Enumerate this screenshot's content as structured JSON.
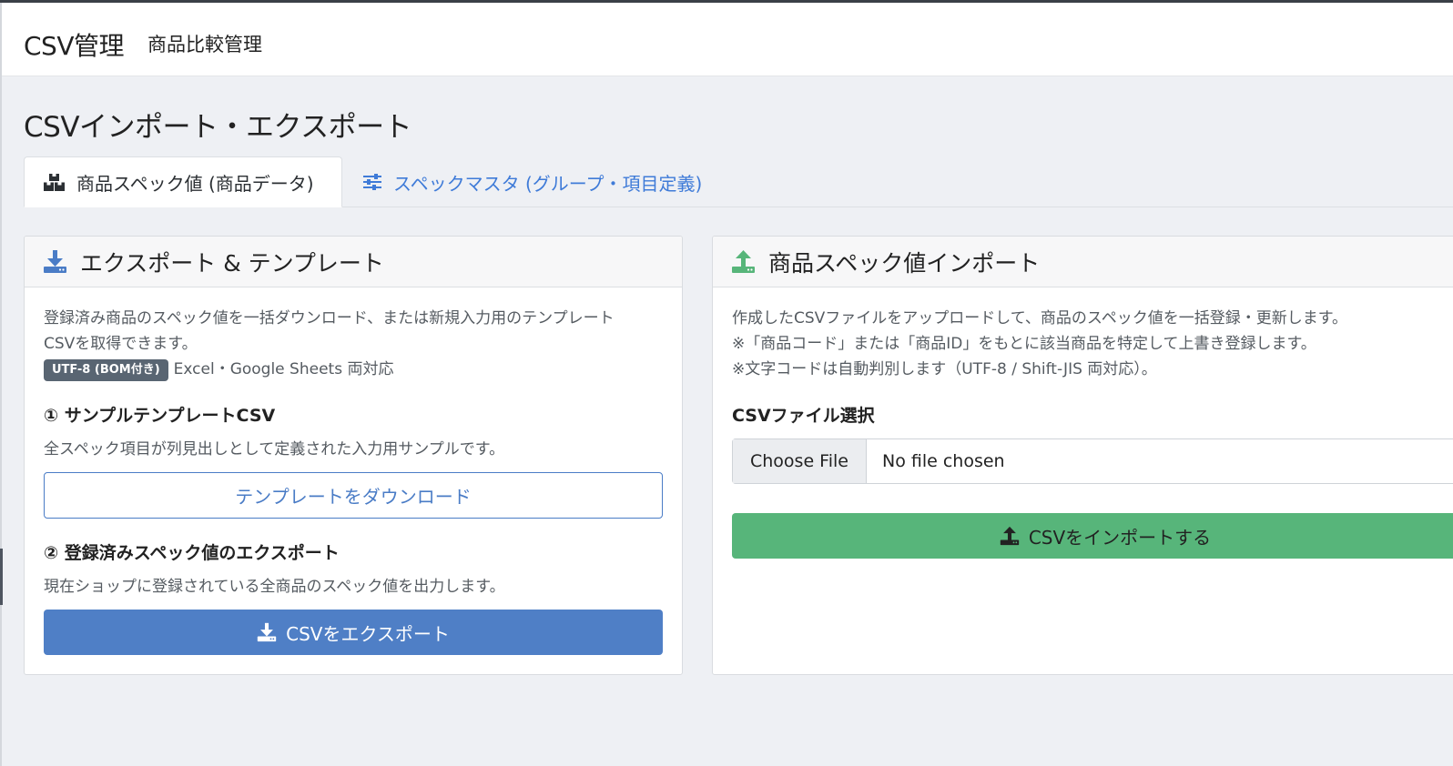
{
  "header": {
    "title": "CSV管理",
    "subtitle": "商品比較管理"
  },
  "page": {
    "title": "CSVインポート・エクスポート"
  },
  "tabs": [
    {
      "label": "商品スペック値 (商品データ)",
      "active": true,
      "icon": "boxes-icon"
    },
    {
      "label": "スペックマスタ (グループ・項目定義)",
      "active": false,
      "icon": "sliders-icon"
    }
  ],
  "export_card": {
    "title": "エクスポート & テンプレート",
    "icon": "download-icon",
    "description_line1": "登録済み商品のスペック値を一括ダウンロード、または新規入力用のテンプレート",
    "description_line2": "CSVを取得できます。",
    "badge": "UTF-8 (BOM付き)",
    "badge_note": "Excel・Google Sheets 両対応",
    "section1": {
      "heading": "① サンプルテンプレートCSV",
      "description": "全スペック項目が列見出しとして定義された入力用サンプルです。",
      "button": "テンプレートをダウンロード"
    },
    "section2": {
      "heading": "② 登録済みスペック値のエクスポート",
      "description": "現在ショップに登録されている全商品のスペック値を出力します。",
      "button": "CSVをエクスポート"
    }
  },
  "import_card": {
    "title": "商品スペック値インポート",
    "icon": "upload-icon",
    "description_line1": "作成したCSVファイルをアップロードして、商品のスペック値を一括登録・更新します。",
    "description_line2": "※「商品コード」または「商品ID」をもとに該当商品を特定して上書き登録します。",
    "description_line3": "※文字コードは自動判別します（UTF-8 / Shift-JIS 両対応）。",
    "file_label": "CSVファイル選択",
    "file_button": "Choose File",
    "file_status": "No file chosen",
    "import_button": "CSVをインポートする"
  },
  "colors": {
    "primary": "#4f7fc6",
    "success": "#57b57a",
    "link": "#3f7bd8",
    "badge": "#596572",
    "background": "#eef0f4"
  }
}
